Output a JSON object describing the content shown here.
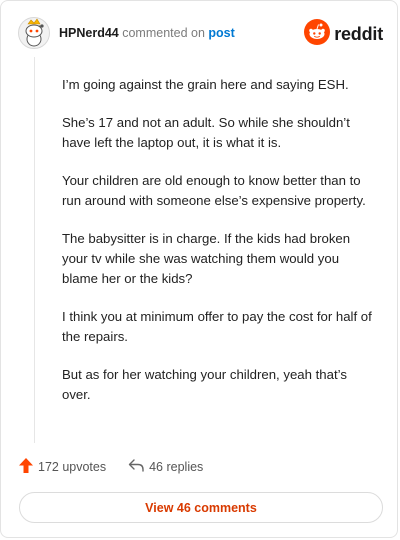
{
  "header": {
    "username": "HPNerd44",
    "commented_text": "commented on",
    "post_link": "post",
    "brand": "reddit"
  },
  "comment": {
    "paragraphs": [
      "I’m going against the grain here and saying ESH.",
      "She’s 17 and not an adult. So while she shouldn’t have left the laptop out, it is what it is.",
      "Your children are old enough to know better than to run around with someone else’s expensive property.",
      "The babysitter is in charge. If the kids had broken your tv while she was watching them would you blame her or the kids?",
      "I think you at minimum offer to pay the cost for half of the repairs.",
      "But as for her watching your children, yeah that’s over."
    ]
  },
  "actions": {
    "upvotes": "172 upvotes",
    "replies": "46 replies",
    "view_comments": "View 46 comments"
  },
  "icons": {
    "avatar": "snoo-avatar-icon",
    "logo": "reddit-logo-icon",
    "upvote": "upvote-arrow-icon",
    "reply": "reply-arrow-icon"
  },
  "colors": {
    "link": "#0079d3",
    "accent": "#ff4500",
    "button_text": "#d93a00"
  }
}
